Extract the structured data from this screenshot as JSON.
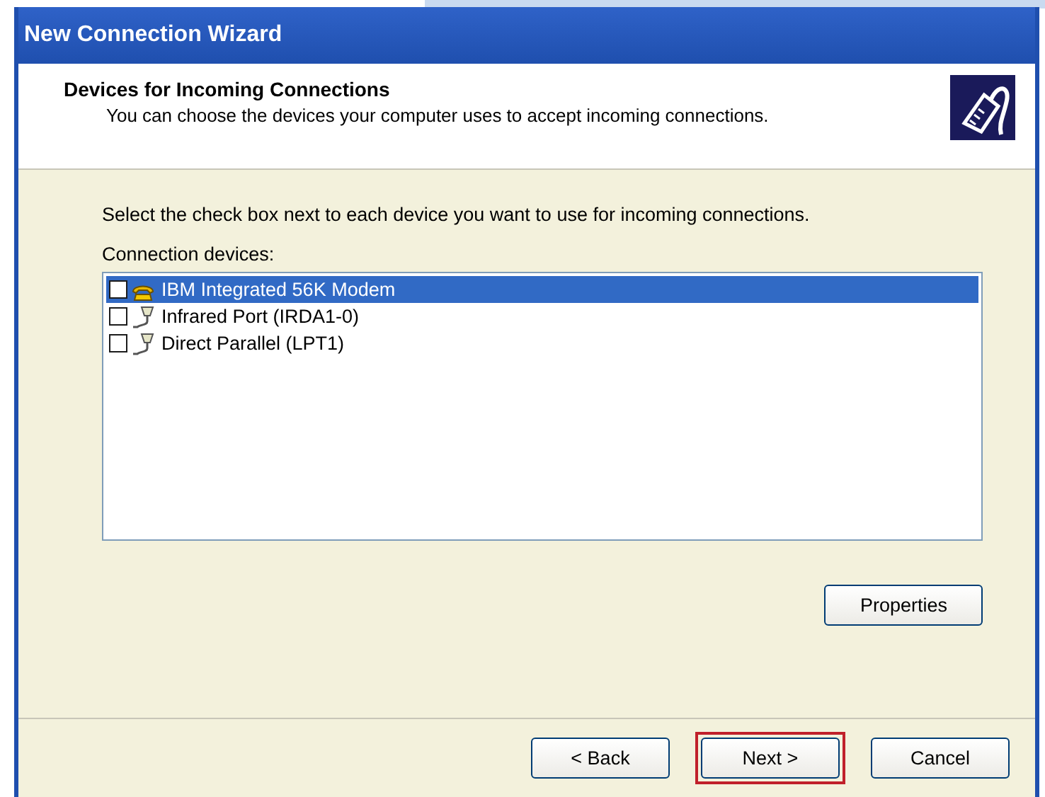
{
  "window": {
    "title": "New Connection Wizard"
  },
  "header": {
    "title": "Devices for Incoming Connections",
    "subtitle": "You can choose the devices your computer uses to accept incoming connections."
  },
  "instruction": "Select the check box next to each device you want to use for incoming connections.",
  "devices_label": "Connection devices:",
  "devices": [
    {
      "name": "IBM Integrated 56K Modem",
      "kind": "modem",
      "checked": false,
      "selected": true
    },
    {
      "name": "Infrared Port (IRDA1-0)",
      "kind": "port",
      "checked": false,
      "selected": false
    },
    {
      "name": "Direct Parallel (LPT1)",
      "kind": "port",
      "checked": false,
      "selected": false
    }
  ],
  "properties_button": "Properties",
  "buttons": [
    {
      "label": "< Back",
      "highlighted": false
    },
    {
      "label": "Next >",
      "highlighted": true
    },
    {
      "label": "Cancel",
      "highlighted": false
    }
  ]
}
